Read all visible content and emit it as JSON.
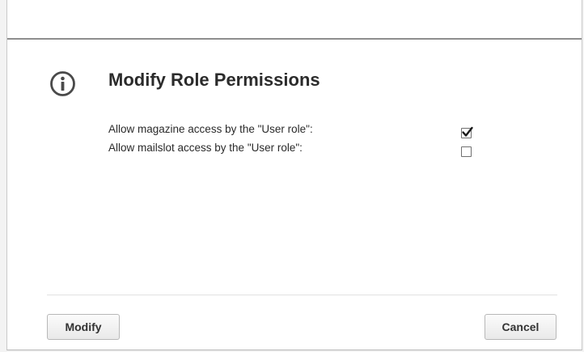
{
  "dialog": {
    "title": "Modify Role Permissions",
    "icon": "info-icon",
    "permissions": [
      {
        "label": "Allow magazine access by the \"User role\":",
        "checked": true
      },
      {
        "label": "Allow mailslot access by the \"User role\":",
        "checked": false
      }
    ],
    "buttons": {
      "modify_label": "Modify",
      "cancel_label": "Cancel"
    }
  }
}
